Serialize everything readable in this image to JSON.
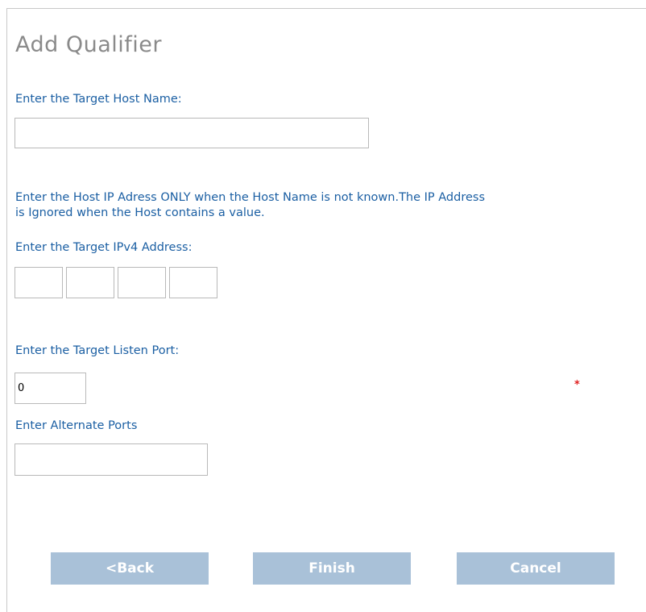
{
  "page": {
    "title": "Add Qualifier"
  },
  "host": {
    "label": "Enter the Target Host Name:",
    "value": ""
  },
  "ip": {
    "info_line1": "Enter the Host IP Adress ONLY when the Host Name is not known.The IP Address",
    "info_line2": "is Ignored when the Host contains a value.",
    "label": "Enter the Target IPv4 Address:",
    "octets": [
      "",
      "",
      "",
      ""
    ]
  },
  "port": {
    "label": "Enter the Target Listen Port:",
    "value": "0",
    "required_marker": "*"
  },
  "alternate_ports": {
    "label": "Enter Alternate Ports",
    "value": ""
  },
  "buttons": {
    "back": "<Back",
    "finish": "Finish",
    "cancel": "Cancel"
  },
  "colors": {
    "label_text": "#1b5fa3",
    "title_text": "#8a8a8a",
    "button_bg": "#a9c1d8",
    "required": "#e02020"
  }
}
